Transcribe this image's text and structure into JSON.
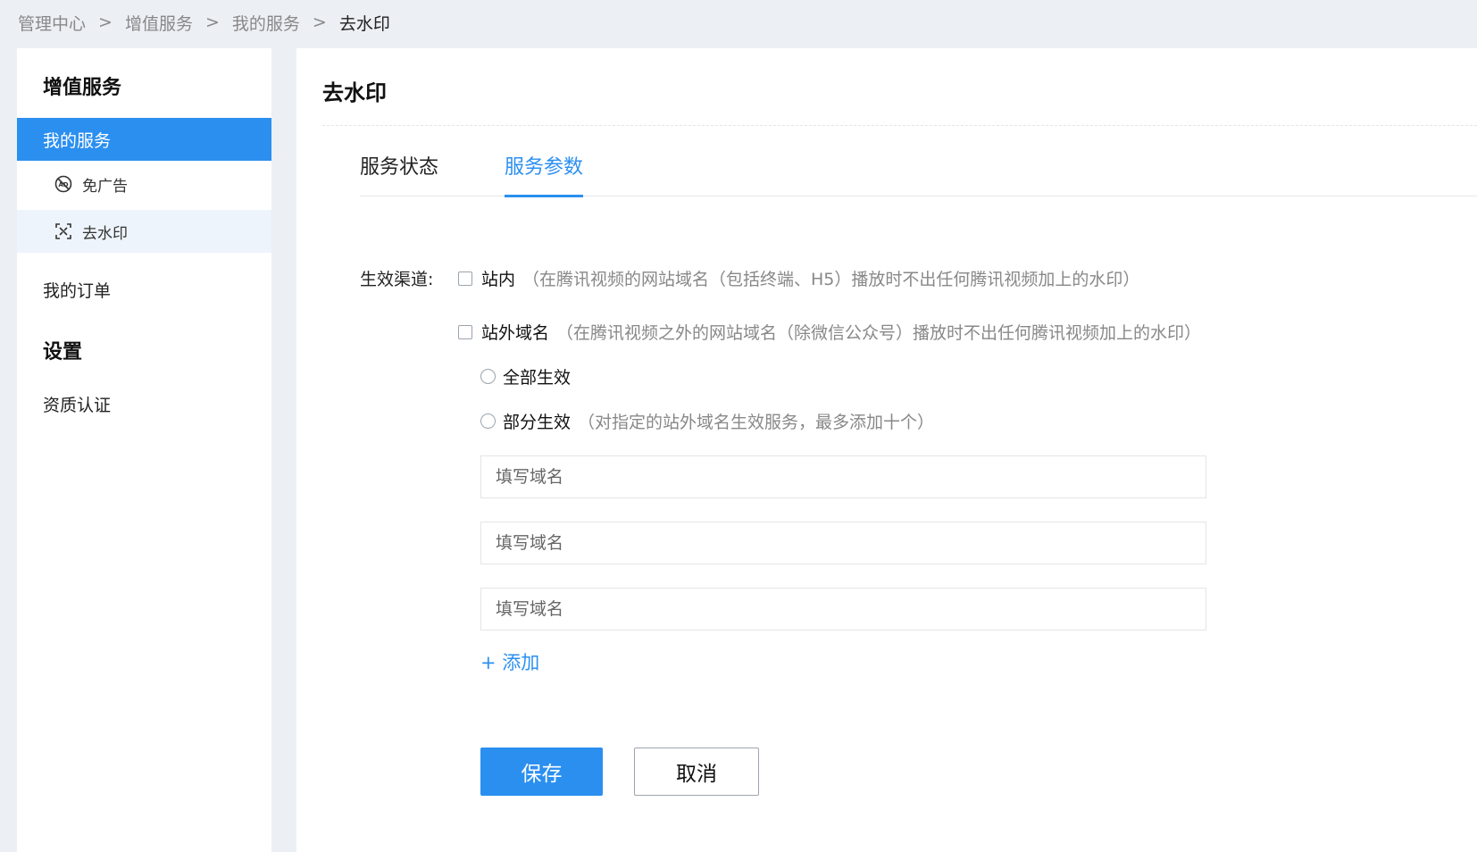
{
  "breadcrumb": {
    "items": [
      "管理中心",
      "增值服务",
      "我的服务"
    ],
    "current": "去水印",
    "separator": ">"
  },
  "sidebar": {
    "heading_services": "增值服务",
    "my_services": "我的服务",
    "sub_items": [
      {
        "label": "免广告",
        "icon": "no-ad-icon"
      },
      {
        "label": "去水印",
        "icon": "watermark-remove-icon"
      }
    ],
    "my_orders": "我的订单",
    "heading_settings": "设置",
    "certification": "资质认证"
  },
  "main": {
    "title": "去水印",
    "tabs": [
      {
        "label": "服务状态",
        "active": false
      },
      {
        "label": "服务参数",
        "active": true
      }
    ],
    "channel_label": "生效渠道:",
    "options": {
      "onsite": {
        "label": "站内",
        "desc": "（在腾讯视频的网站域名（包括终端、H5）播放时不出任何腾讯视频加上的水印）",
        "checked": false
      },
      "offsite": {
        "label": "站外域名",
        "desc": "（在腾讯视频之外的网站域名（除微信公众号）播放时不出任何腾讯视频加上的水印）",
        "checked": false
      },
      "all_effective": {
        "label": "全部生效",
        "selected": false
      },
      "partial_effective": {
        "label": "部分生效",
        "desc": "（对指定的站外域名生效服务，最多添加十个）",
        "selected": false
      }
    },
    "domain_inputs": [
      {
        "placeholder": "填写域名",
        "value": ""
      },
      {
        "placeholder": "填写域名",
        "value": ""
      },
      {
        "placeholder": "填写域名",
        "value": ""
      }
    ],
    "add_label": "+ 添加",
    "save_label": "保存",
    "cancel_label": "取消"
  },
  "colors": {
    "accent": "#2b8ff0",
    "page_bg": "#eceff4",
    "muted_text": "#888888"
  }
}
